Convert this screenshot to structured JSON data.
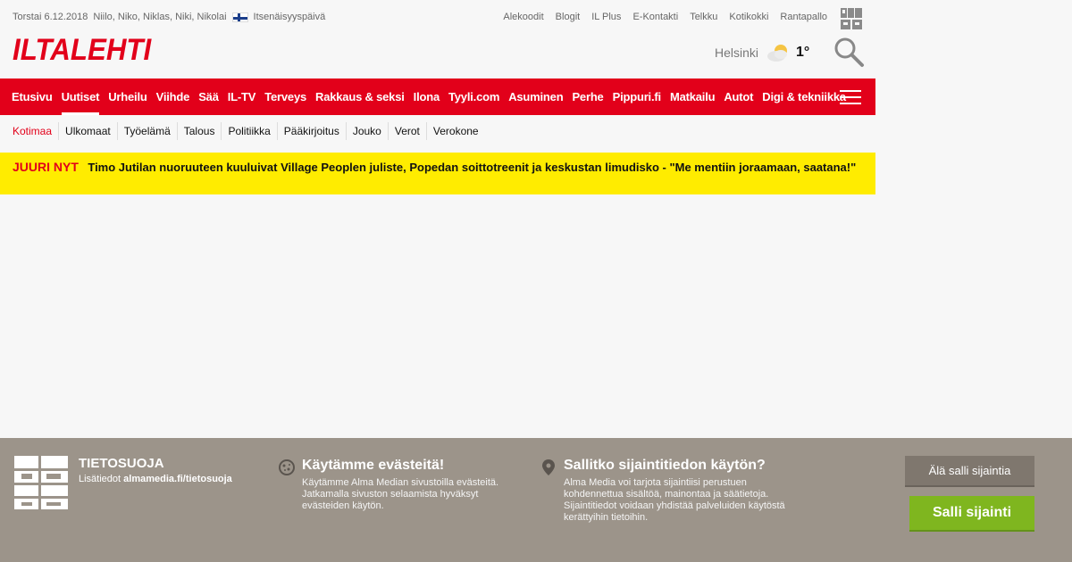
{
  "topbar": {
    "date": "Torstai 6.12.2018",
    "namedays": "Niilo, Niko, Niklas, Niki, Nikolai",
    "holiday": "Itsenäisyyspäivä",
    "links": [
      "Alekoodit",
      "Blogit",
      "IL Plus",
      "E-Kontakti",
      "Telkku",
      "Kotikokki",
      "Rantapallo"
    ]
  },
  "header": {
    "logo": "ILTALEHTI",
    "weather": {
      "city": "Helsinki",
      "temp": "1°"
    }
  },
  "mainnav": {
    "items": [
      "Etusivu",
      "Uutiset",
      "Urheilu",
      "Viihde",
      "Sää",
      "IL-TV",
      "Terveys",
      "Rakkaus & seksi",
      "Ilona",
      "Tyyli.com",
      "Asuminen",
      "Perhe",
      "Pippuri.fi",
      "Matkailu",
      "Autot",
      "Digi & tekniikka"
    ],
    "active": "Uutiset"
  },
  "subnav": {
    "items": [
      "Kotimaa",
      "Ulkomaat",
      "Työelämä",
      "Talous",
      "Politiikka",
      "Pääkirjoitus",
      "Jouko",
      "Verot",
      "Verokone"
    ]
  },
  "breaking": {
    "label": "JUURI NYT",
    "headline": "Timo Jutilan nuoruuteen kuuluivat Village Peoplen juliste, Popedan soittotreenit ja keskustan limudisko - \"Me mentiin joraamaan, saatana!\""
  },
  "privacy": {
    "title": "TIETOSUOJA",
    "more_prefix": "Lisätiedot",
    "more_link": "almamedia.fi/tietosuoja",
    "cookies_title": "Käytämme evästeitä!",
    "cookies_text": "Käytämme Alma Median sivustoilla evästeitä. Jatkamalla sivuston selaamista hyväksyt evästeiden käytön.",
    "location_title": "Sallitko sijaintitiedon käytön?",
    "location_text": "Alma Media voi tarjota sijaintiisi perustuen kohdennettua sisältöä, mainontaa ja säätietoja. Sijaintitiedot voidaan yhdistää palveluiden käytöstä kerättyihin tietoihin.",
    "deny_label": "Älä salli sijaintia",
    "allow_label": "Salli sijainti"
  },
  "colors": {
    "brand_red": "#e2001a",
    "breaking_yellow": "#ffec00",
    "privacy_bg": "#9c948a",
    "allow_green": "#7fb61f"
  }
}
